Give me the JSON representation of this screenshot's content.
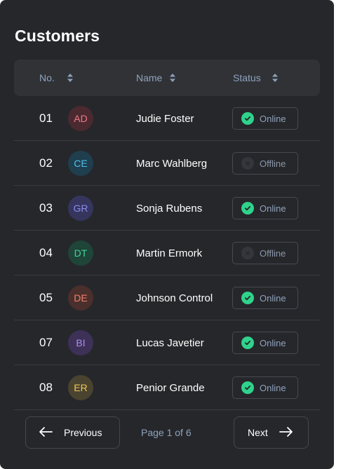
{
  "title": "Customers",
  "columns": {
    "no": "No.",
    "name": "Name",
    "status": "Status"
  },
  "customers": [
    {
      "no": "01",
      "initials": "AD",
      "name": "Judie Foster",
      "status": "Online",
      "avatar_bg": "#4a2a30",
      "avatar_fg": "#f07a86"
    },
    {
      "no": "02",
      "initials": "CE",
      "name": "Marc Wahlberg",
      "status": "Offline",
      "avatar_bg": "#1f3e4e",
      "avatar_fg": "#4fc1ea"
    },
    {
      "no": "03",
      "initials": "GR",
      "name": "Sonja Rubens",
      "status": "Online",
      "avatar_bg": "#35355e",
      "avatar_fg": "#8b8af0"
    },
    {
      "no": "04",
      "initials": "DT",
      "name": "Martin Ermork",
      "status": "Offline",
      "avatar_bg": "#1f4438",
      "avatar_fg": "#3fd49a"
    },
    {
      "no": "05",
      "initials": "DE",
      "name": "Johnson Control",
      "status": "Online",
      "avatar_bg": "#4a2f2c",
      "avatar_fg": "#f2806c"
    },
    {
      "no": "07",
      "initials": "BI",
      "name": "Lucas Javetier",
      "status": "Online",
      "avatar_bg": "#3e3158",
      "avatar_fg": "#ad8cf2"
    },
    {
      "no": "08",
      "initials": "ER",
      "name": "Penior Grande",
      "status": "Online",
      "avatar_bg": "#4a4330",
      "avatar_fg": "#f0c756"
    }
  ],
  "pagination": {
    "previous_label": "Previous",
    "page_info": "Page 1 of 6",
    "next_label": "Next"
  },
  "colors": {
    "online": "#2fd38c",
    "accent_text": "#8fa3bd",
    "background": "#26272b"
  },
  "icons": {
    "sort": "sort-icon",
    "online": "check-circle-icon",
    "offline": "offline-dot-icon",
    "prev": "arrow-left-icon",
    "next": "arrow-right-icon"
  }
}
